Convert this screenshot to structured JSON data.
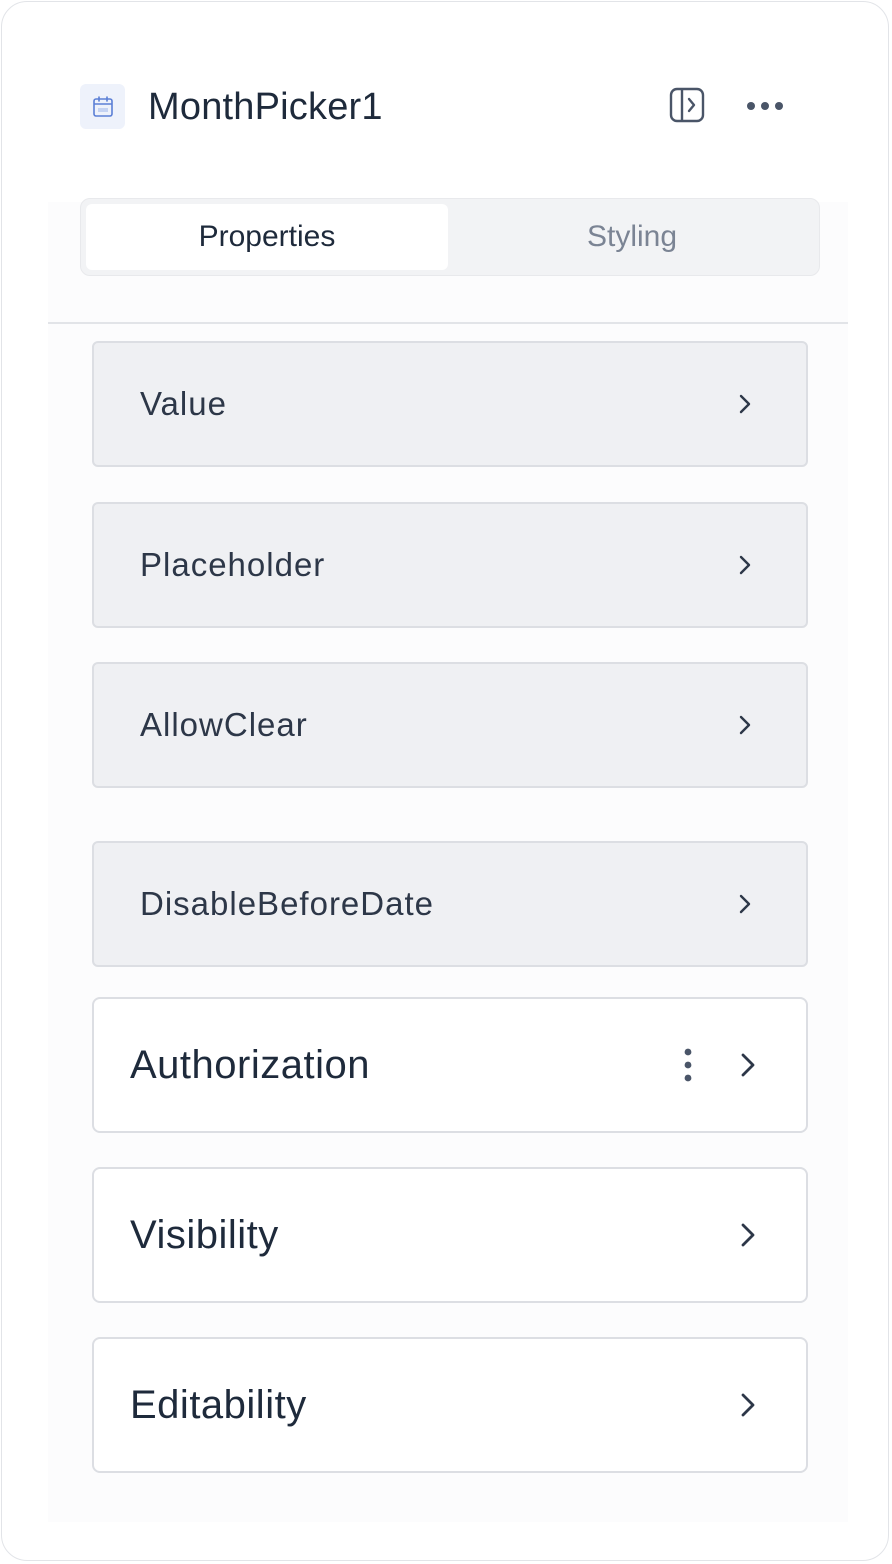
{
  "header": {
    "component_icon": "calendar-icon",
    "title": "MonthPicker1",
    "panel_toggle_icon": "panel-toggle-icon",
    "more_icon": "more-horizontal-icon"
  },
  "tabs": [
    {
      "label": "Properties",
      "active": true
    },
    {
      "label": "Styling",
      "active": false
    }
  ],
  "properties": [
    {
      "label": "Value",
      "icon": "chevron-right-icon"
    },
    {
      "label": "Placeholder",
      "icon": "chevron-right-icon"
    },
    {
      "label": "AllowClear",
      "icon": "chevron-right-icon"
    },
    {
      "label": "DisableBeforeDate",
      "icon": "chevron-right-icon"
    }
  ],
  "sections": [
    {
      "label": "Authorization",
      "has_menu": true,
      "menu_icon": "more-vertical-icon",
      "icon": "chevron-right-icon"
    },
    {
      "label": "Visibility",
      "has_menu": false,
      "icon": "chevron-right-icon"
    },
    {
      "label": "Editability",
      "has_menu": false,
      "icon": "chevron-right-icon"
    }
  ],
  "colors": {
    "title_text": "#1e2a3b",
    "property_bg": "#eff0f3",
    "border": "#dcdee3",
    "inactive_tab_text": "#7b8494",
    "icon_accent": "#5b7fd6"
  }
}
